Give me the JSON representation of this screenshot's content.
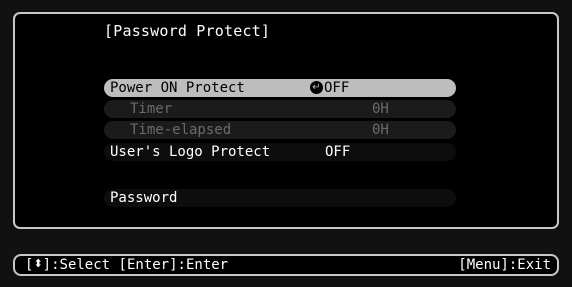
{
  "menu": {
    "title": "[Password Protect]",
    "items": [
      {
        "label": "Power ON Protect",
        "value": "OFF",
        "state": "selected",
        "icon": "enter-icon"
      },
      {
        "label": "Timer",
        "value": "0H",
        "state": "disabled"
      },
      {
        "label": "Time-elapsed",
        "value": "0H",
        "state": "disabled"
      },
      {
        "label": "User's Logo Protect",
        "value": "OFF",
        "state": "normal"
      },
      {
        "label": "Password",
        "value": "",
        "state": "normal"
      }
    ]
  },
  "statusbar": {
    "select_prefix": "[",
    "select_icon": "up-down-arrow-icon",
    "select_suffix": "]:Select",
    "enter_hint": "[Enter]:Enter",
    "exit_hint": "[Menu]:Exit"
  },
  "colors": {
    "background": "#000000",
    "border": "#c8c8c8",
    "selected_row": "#bdbdbd",
    "disabled_text": "#6a6a6a"
  }
}
